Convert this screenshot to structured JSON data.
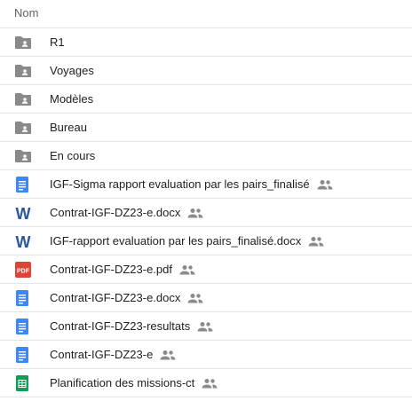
{
  "header": {
    "column_name": "Nom"
  },
  "files": [
    {
      "name": "R1",
      "type": "shared-folder",
      "shared": false
    },
    {
      "name": "Voyages",
      "type": "shared-folder",
      "shared": false
    },
    {
      "name": "Modèles",
      "type": "shared-folder",
      "shared": false
    },
    {
      "name": "Bureau",
      "type": "shared-folder",
      "shared": false
    },
    {
      "name": "En cours",
      "type": "shared-folder",
      "shared": false
    },
    {
      "name": "IGF-Sigma rapport evaluation par les pairs_finalisé",
      "type": "google-doc",
      "shared": true
    },
    {
      "name": "Contrat-IGF-DZ23-e.docx",
      "type": "word",
      "shared": true
    },
    {
      "name": "IGF-rapport evaluation par les pairs_finalisé.docx",
      "type": "word",
      "shared": true
    },
    {
      "name": "Contrat-IGF-DZ23-e.pdf",
      "type": "pdf",
      "shared": true
    },
    {
      "name": "Contrat-IGF-DZ23-e.docx",
      "type": "google-doc",
      "shared": true
    },
    {
      "name": "Contrat-IGF-DZ23-resultats",
      "type": "google-doc",
      "shared": true
    },
    {
      "name": "Contrat-IGF-DZ23-e",
      "type": "google-doc",
      "shared": true
    },
    {
      "name": "Planification des missions-ct",
      "type": "google-sheet",
      "shared": true
    }
  ],
  "icons": {
    "shared-folder": "shared-folder-icon",
    "google-doc": "google-docs-icon",
    "word": "word-icon",
    "pdf": "pdf-icon",
    "google-sheet": "google-sheets-icon",
    "shared": "people-icon"
  },
  "icon_labels": {
    "word": "W",
    "pdf": "PDF"
  },
  "colors": {
    "folder": "#8a8a8a",
    "google_doc": "#4285f4",
    "word": "#2b579a",
    "pdf": "#db4437",
    "google_sheet": "#0f9d58",
    "shared_icon": "#8a8a8a"
  }
}
